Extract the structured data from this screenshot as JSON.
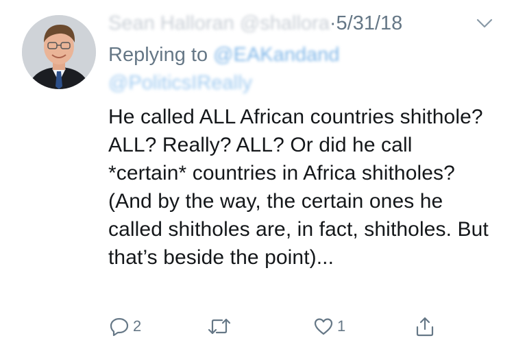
{
  "tweet": {
    "author_name": "Sean Halloran",
    "author_handle": "@shallora",
    "separator": "·",
    "date": "5/31/18",
    "replying_prefix": "Replying to",
    "replying_to_1": "@EAKandand",
    "replying_to_2": "@PoliticsIReally",
    "text": "He called ALL African countries shithole? ALL? Really? ALL? Or did he call *certain* countries in Africa shitholes? (And by the way, the certain ones he called shitholes are, in fact, shitholes. But that’s beside the point)...",
    "reply_count": "2",
    "retweet_count": "",
    "like_count": "1",
    "icons": {
      "reply": "reply-icon",
      "retweet": "retweet-icon",
      "like": "heart-icon",
      "share": "share-icon",
      "menu": "chevron-down-icon"
    },
    "colors": {
      "text": "#14171a",
      "secondary": "#657786",
      "link": "#1da1f2"
    }
  }
}
